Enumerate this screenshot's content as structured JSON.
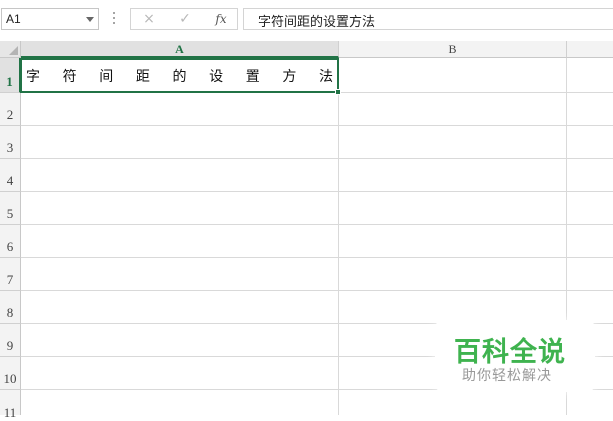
{
  "namebox": {
    "value": "A1"
  },
  "formula_bar": {
    "cancel_icon": "×",
    "enter_icon": "✓",
    "fx_label": "fx",
    "content": "字符间距的设置方法"
  },
  "columns": [
    {
      "label": "A",
      "selected": true
    },
    {
      "label": "B",
      "selected": false
    }
  ],
  "rows": [
    "1",
    "2",
    "3",
    "4",
    "5",
    "6",
    "7",
    "8",
    "9",
    "10",
    "11"
  ],
  "cells": {
    "A1": {
      "chars": [
        "字",
        "符",
        "间",
        "距",
        "的",
        "设",
        "置",
        "方",
        "法"
      ]
    }
  },
  "watermark": {
    "title": "百科全说",
    "subtitle": "助你轻松解决"
  },
  "colors": {
    "accent": "#217346",
    "watermark_green": "#3fb34f"
  }
}
